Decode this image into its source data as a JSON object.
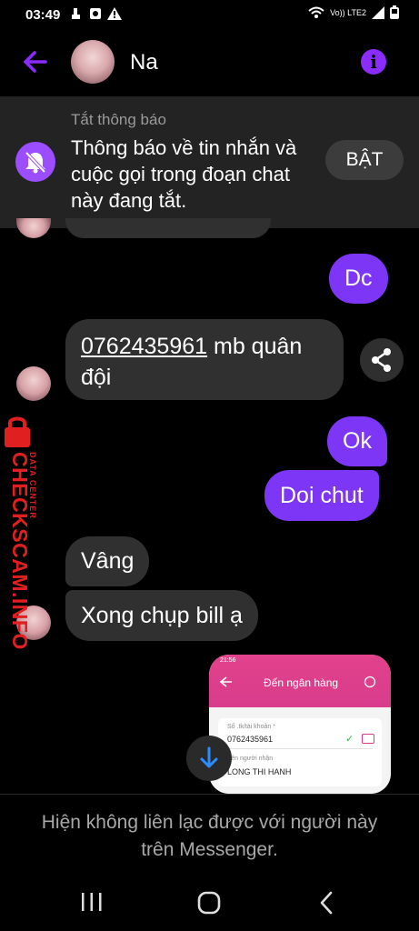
{
  "status_bar": {
    "time": "03:49",
    "network": "Vo)) LTE2"
  },
  "header": {
    "contact_name": "Na"
  },
  "notification": {
    "subtitle": "Tắt thông báo",
    "message": "Thông báo về tin nhắn và cuộc gọi trong đoạn chat này đang tắt.",
    "action_label": "BẬT"
  },
  "messages": [
    {
      "sender": "me",
      "text": "Dc"
    },
    {
      "sender": "contact",
      "link_text": "0762435961",
      "text": " mb quân đội"
    },
    {
      "sender": "me",
      "text": "Ok"
    },
    {
      "sender": "me",
      "text": "Doi chut"
    },
    {
      "sender": "contact",
      "text": "Vâng"
    },
    {
      "sender": "contact",
      "text": "Xong chụp bill ạ"
    }
  ],
  "image_preview": {
    "time": "21:56",
    "title": "Đến ngân hàng",
    "account_label": "Số .tk/tài khoản *",
    "account_value": "0762435961",
    "recipient_label": "Tên người nhận",
    "recipient_value": "LONG THI HANH"
  },
  "watermark": {
    "brand": "CHECKSCAM.INFO",
    "caption": "DATA CENTER"
  },
  "footer": {
    "text": "Hiện không liên lạc được với người này trên Messenger."
  },
  "colors": {
    "accent": "#8b2cff",
    "outgoing_bubble": "#7d36f5",
    "incoming_bubble": "#303030",
    "watermark": "#e02020"
  }
}
